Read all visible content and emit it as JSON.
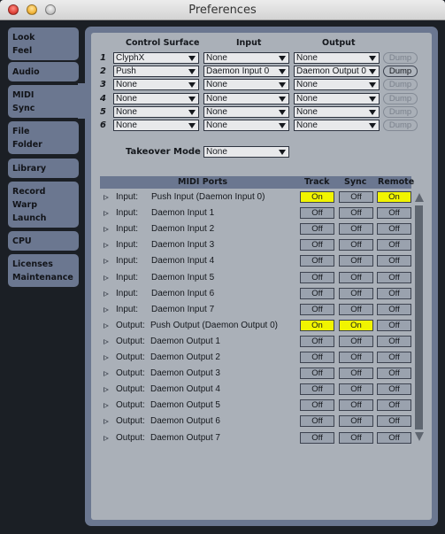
{
  "window": {
    "title": "Preferences",
    "controls": [
      "close",
      "minimize",
      "zoom"
    ]
  },
  "sidebar": {
    "tabs": [
      {
        "lines": [
          "Look",
          "Feel"
        ],
        "active": false
      },
      {
        "lines": [
          "Audio"
        ],
        "active": false
      },
      {
        "lines": [
          "MIDI",
          "Sync"
        ],
        "active": true
      },
      {
        "lines": [
          "File",
          "Folder"
        ],
        "active": false
      },
      {
        "lines": [
          "Library"
        ],
        "active": false
      },
      {
        "lines": [
          "Record",
          "Warp",
          "Launch"
        ],
        "active": false
      },
      {
        "lines": [
          "CPU"
        ],
        "active": false
      },
      {
        "lines": [
          "Licenses",
          "Maintenance"
        ],
        "active": false
      }
    ]
  },
  "control_surfaces": {
    "headers": {
      "surface": "Control Surface",
      "input": "Input",
      "output": "Output"
    },
    "dump_label": "Dump",
    "rows": [
      {
        "num": "1",
        "surface": "ClyphX",
        "input": "None",
        "output": "None",
        "dump_enabled": false
      },
      {
        "num": "2",
        "surface": "Push",
        "input": "Daemon Input 0",
        "output": "Daemon Output 0",
        "dump_enabled": true
      },
      {
        "num": "3",
        "surface": "None",
        "input": "None",
        "output": "None",
        "dump_enabled": false
      },
      {
        "num": "4",
        "surface": "None",
        "input": "None",
        "output": "None",
        "dump_enabled": false
      },
      {
        "num": "5",
        "surface": "None",
        "input": "None",
        "output": "None",
        "dump_enabled": false
      },
      {
        "num": "6",
        "surface": "None",
        "input": "None",
        "output": "None",
        "dump_enabled": false
      }
    ]
  },
  "takeover": {
    "label": "Takeover Mode",
    "value": "None"
  },
  "midi_ports": {
    "headers": {
      "ports": "MIDI Ports",
      "track": "Track",
      "sync": "Sync",
      "remote": "Remote"
    },
    "on_label": "On",
    "off_label": "Off",
    "on_color": "#f1f400",
    "rows": [
      {
        "kind": "Input:",
        "name": "Push Input (Daemon Input 0)",
        "track": "On",
        "sync": "Off",
        "remote": "On"
      },
      {
        "kind": "Input:",
        "name": "Daemon Input 1",
        "track": "Off",
        "sync": "Off",
        "remote": "Off"
      },
      {
        "kind": "Input:",
        "name": "Daemon Input 2",
        "track": "Off",
        "sync": "Off",
        "remote": "Off"
      },
      {
        "kind": "Input:",
        "name": "Daemon Input 3",
        "track": "Off",
        "sync": "Off",
        "remote": "Off"
      },
      {
        "kind": "Input:",
        "name": "Daemon Input 4",
        "track": "Off",
        "sync": "Off",
        "remote": "Off"
      },
      {
        "kind": "Input:",
        "name": "Daemon Input 5",
        "track": "Off",
        "sync": "Off",
        "remote": "Off"
      },
      {
        "kind": "Input:",
        "name": "Daemon Input 6",
        "track": "Off",
        "sync": "Off",
        "remote": "Off"
      },
      {
        "kind": "Input:",
        "name": "Daemon Input 7",
        "track": "Off",
        "sync": "Off",
        "remote": "Off"
      },
      {
        "kind": "Output:",
        "name": "Push Output (Daemon Output 0)",
        "track": "On",
        "sync": "On",
        "remote": "Off"
      },
      {
        "kind": "Output:",
        "name": "Daemon Output 1",
        "track": "Off",
        "sync": "Off",
        "remote": "Off"
      },
      {
        "kind": "Output:",
        "name": "Daemon Output 2",
        "track": "Off",
        "sync": "Off",
        "remote": "Off"
      },
      {
        "kind": "Output:",
        "name": "Daemon Output 3",
        "track": "Off",
        "sync": "Off",
        "remote": "Off"
      },
      {
        "kind": "Output:",
        "name": "Daemon Output 4",
        "track": "Off",
        "sync": "Off",
        "remote": "Off"
      },
      {
        "kind": "Output:",
        "name": "Daemon Output 5",
        "track": "Off",
        "sync": "Off",
        "remote": "Off"
      },
      {
        "kind": "Output:",
        "name": "Daemon Output 6",
        "track": "Off",
        "sync": "Off",
        "remote": "Off"
      },
      {
        "kind": "Output:",
        "name": "Daemon Output 7",
        "track": "Off",
        "sync": "Off",
        "remote": "Off"
      }
    ]
  }
}
